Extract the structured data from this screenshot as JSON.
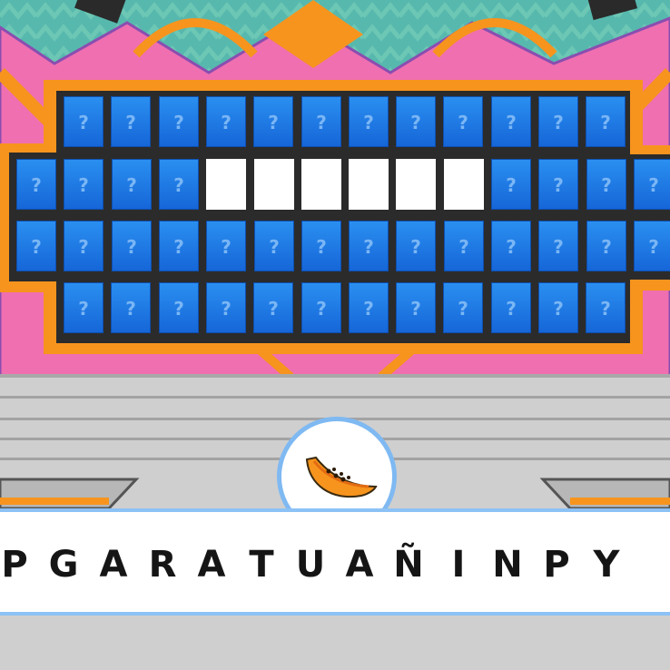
{
  "board": {
    "hidden_symbol": "?",
    "rows": [
      {
        "cols": 12,
        "blanks": []
      },
      {
        "cols": 14,
        "blanks": [
          4,
          5,
          6,
          7,
          8,
          9
        ]
      },
      {
        "cols": 14,
        "blanks": []
      },
      {
        "cols": 12,
        "blanks": []
      }
    ]
  },
  "clue": {
    "icon": "papaya-slice-icon"
  },
  "letters": [
    "P",
    "G",
    "A",
    "R",
    "A",
    "T",
    "U",
    "A",
    "Ñ",
    "I",
    "N",
    "P",
    "Y"
  ],
  "colors": {
    "pink": "#ef6fb0",
    "orange": "#f7941d",
    "teal": "#5fbfad",
    "tile_blue": "#1e7ae6",
    "board_frame": "#2b2b2b",
    "bar_border": "#8cc2f5"
  }
}
